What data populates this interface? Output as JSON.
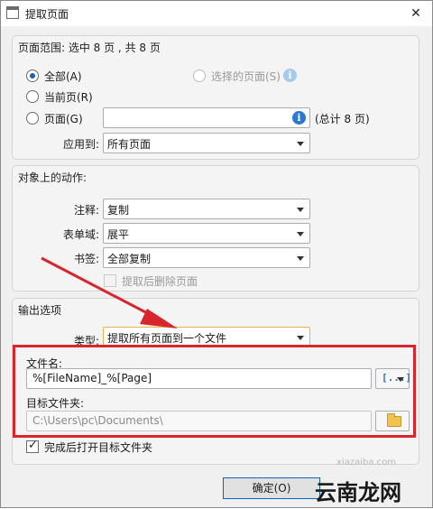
{
  "window": {
    "title": "提取页面",
    "close_glyph": "✕"
  },
  "page_range": {
    "group_title": "页面范围: 选中 8 页 , 共 8 页",
    "all_label": "全部(A)",
    "selected_label": "选择的页面(S)",
    "current_label": "当前页(R)",
    "pages_label": "页面(G)",
    "pages_value": "",
    "total_label": "(总计 8 页)",
    "apply_to_label": "应用到:",
    "apply_to_value": "所有页面"
  },
  "actions": {
    "group_title": "对象上的动作:",
    "annot_label": "注释:",
    "annot_value": "复制",
    "form_label": "表单域:",
    "form_value": "展平",
    "bookmark_label": "书签:",
    "bookmark_value": "全部复制",
    "delete_label": "提取后删除页面"
  },
  "output": {
    "group_title": "输出选项",
    "type_label": "类型:",
    "type_value": "提取所有页面到一个文件",
    "filename_label": "文件名:",
    "filename_value": "%[FileName]_%[Page]",
    "macro_glyph": "[...]",
    "folder_label": "目标文件夹:",
    "folder_value": "C:\\Users\\pc\\Documents\\",
    "open_folder_label": "完成后打开目标文件夹"
  },
  "buttons": {
    "ok_label": "确定(O)"
  },
  "watermark": {
    "text1": "云南龙网",
    "text2": "xiazaiba.com"
  },
  "colors": {
    "accent": "#1f5fb5",
    "highlight": "#d9262c",
    "info": "#2a78d4"
  }
}
